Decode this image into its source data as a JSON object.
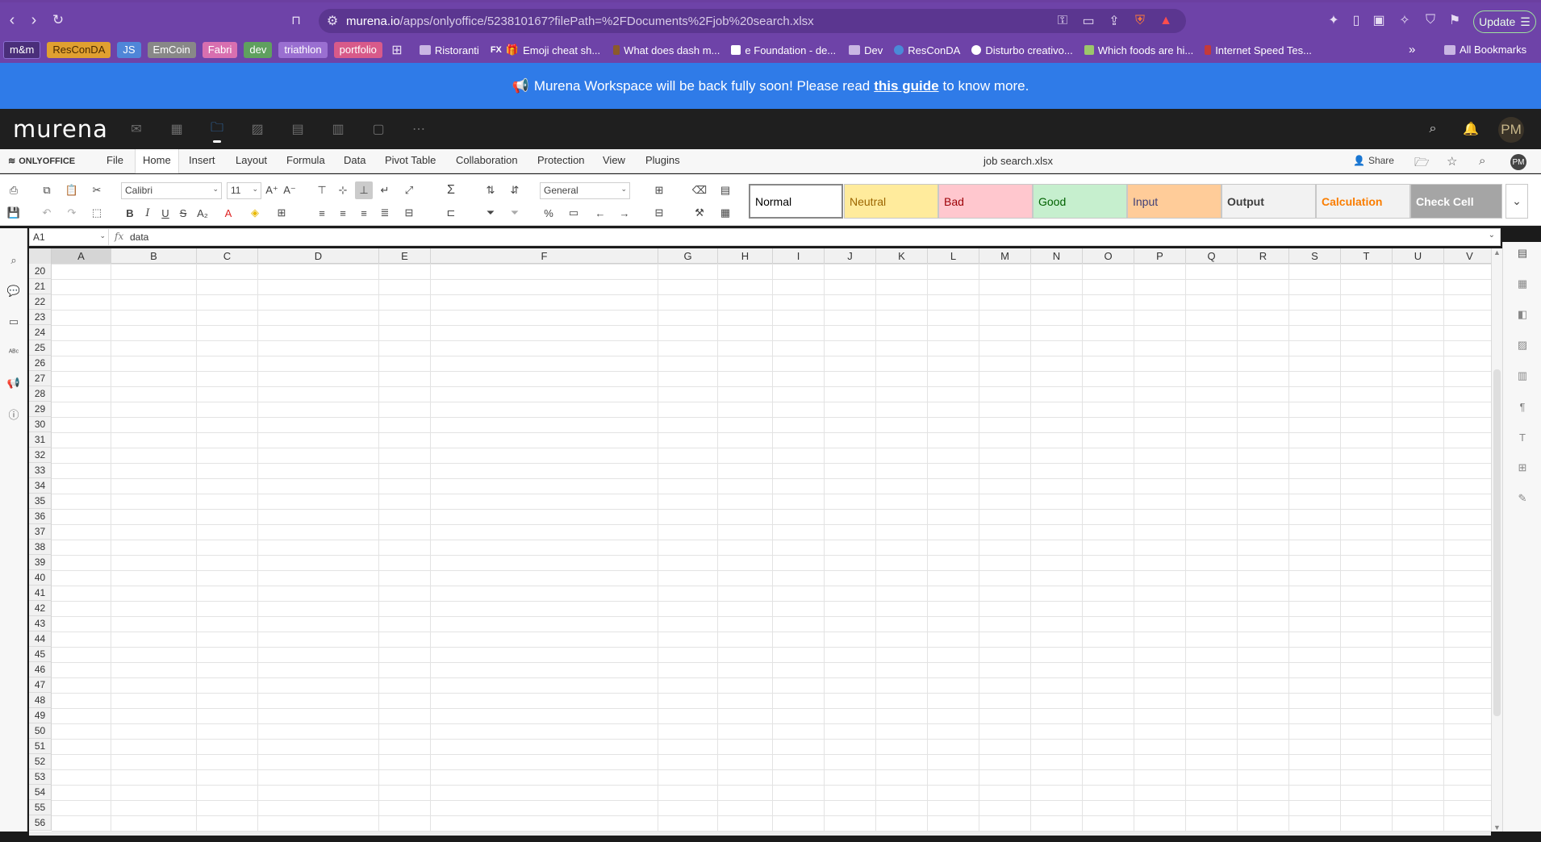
{
  "browser": {
    "url_host": "murena.io",
    "url_path": "/apps/onlyoffice/523810167?filePath=%2FDocuments%2Fjob%20search.xlsx",
    "update_label": "Update"
  },
  "bookmarks": {
    "pills": [
      {
        "label": "m&m",
        "color": "#8a6fd1"
      },
      {
        "label": "ResConDA",
        "color": "#e0a030"
      },
      {
        "label": "JS",
        "color": "#4f86d8"
      },
      {
        "label": "EmCoin",
        "color": "#888888"
      },
      {
        "label": "Fabri",
        "color": "#d86fb0"
      },
      {
        "label": "dev",
        "color": "#5fa05f"
      },
      {
        "label": "triathlon",
        "color": "#9a6fd1"
      },
      {
        "label": "portfolio",
        "color": "#d85a8a"
      }
    ],
    "links": [
      "Ristoranti",
      "Emoji cheat sh...",
      "What does dash m...",
      "e Foundation - de...",
      "Dev",
      "ResConDA",
      "Disturbo creativo...",
      "Which foods are hi...",
      "Internet Speed Tes..."
    ],
    "fx_badge": "FX",
    "overflow": "»",
    "all_bookmarks": "All Bookmarks"
  },
  "banner": {
    "icon": "📢",
    "text_before": "Murena Workspace will be back fully soon! Please read",
    "link": "this guide",
    "text_after": "to know more."
  },
  "murena": {
    "logo": "murena",
    "avatar": "PM"
  },
  "office": {
    "brand": "ONLYOFFICE",
    "menu": [
      "File",
      "Home",
      "Insert",
      "Layout",
      "Formula",
      "Data",
      "Pivot Table",
      "Collaboration",
      "Protection",
      "View",
      "Plugins"
    ],
    "active_menu": "Home",
    "doc_title": "job search.xlsx",
    "share_label": "Share",
    "avatar": "PM"
  },
  "toolbar": {
    "font": "Calibri",
    "size": "11",
    "number_format": "General",
    "styles": [
      {
        "label": "Normal",
        "bg": "#ffffff",
        "fg": "#000000",
        "bold": false
      },
      {
        "label": "Neutral",
        "bg": "#ffeb9c",
        "fg": "#9c6500",
        "bold": false
      },
      {
        "label": "Bad",
        "bg": "#ffc7ce",
        "fg": "#9c0006",
        "bold": false
      },
      {
        "label": "Good",
        "bg": "#c6efce",
        "fg": "#006100",
        "bold": false
      },
      {
        "label": "Input",
        "bg": "#ffcc99",
        "fg": "#3f3f76",
        "bold": false
      },
      {
        "label": "Output",
        "bg": "#f2f2f2",
        "fg": "#3f3f3f",
        "bold": true
      },
      {
        "label": "Calculation",
        "bg": "#f2f2f2",
        "fg": "#fa7d00",
        "bold": true
      },
      {
        "label": "Check Cell",
        "bg": "#a5a5a5",
        "fg": "#ffffff",
        "bold": true
      }
    ]
  },
  "formula_bar": {
    "cell_ref": "A1",
    "fx": "fx",
    "content": "data"
  },
  "grid": {
    "columns": [
      "A",
      "B",
      "C",
      "D",
      "E",
      "F",
      "G",
      "H",
      "I",
      "J",
      "K",
      "L",
      "M",
      "N",
      "O",
      "P",
      "Q",
      "R",
      "S",
      "T",
      "U",
      "V"
    ],
    "selected_column": "A",
    "rows": [
      "20",
      "21",
      "22",
      "23",
      "24",
      "25",
      "26",
      "27",
      "28",
      "29",
      "30",
      "31",
      "32",
      "33",
      "34",
      "35",
      "36",
      "37",
      "38",
      "39",
      "40",
      "41",
      "42",
      "43",
      "44",
      "45",
      "46",
      "47",
      "48",
      "49",
      "50",
      "51",
      "52",
      "53",
      "54",
      "55",
      "56"
    ]
  }
}
